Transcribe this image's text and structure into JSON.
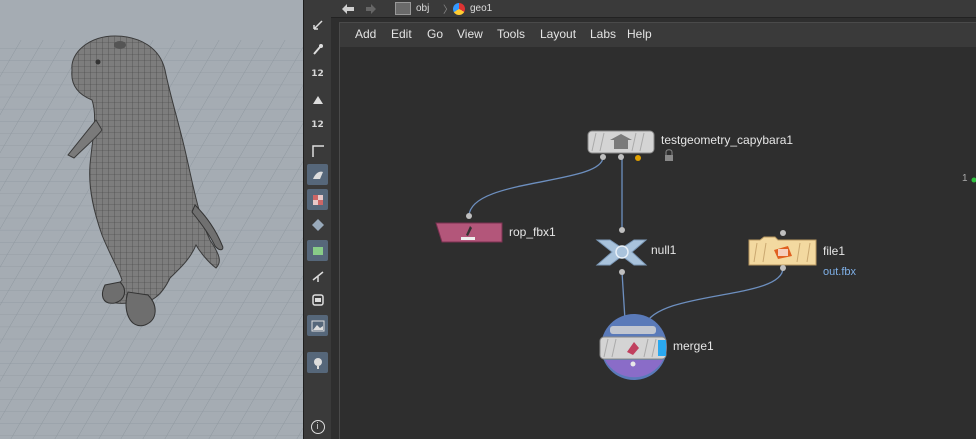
{
  "pathbar": {
    "crumbs": [
      {
        "label": "obj",
        "icon": "obj-folder-icon"
      },
      {
        "label": "geo1",
        "icon": "geo-node-icon"
      }
    ]
  },
  "menubar": {
    "items": [
      "Add",
      "Edit",
      "Go",
      "View",
      "Tools",
      "Layout",
      "Labs",
      "Help"
    ]
  },
  "toolbar": {
    "tools": [
      {
        "icon": "select-arrow-icon",
        "label": ""
      },
      {
        "icon": "paint-brush-icon",
        "label": ""
      },
      {
        "icon": "point-numbers-icon",
        "label": "12"
      },
      {
        "icon": "shade-icon",
        "label": ""
      },
      {
        "icon": "primitive-numbers-icon",
        "label": "12"
      },
      {
        "icon": "corner-icon",
        "label": ""
      },
      {
        "icon": "display-mode-icon",
        "label": ""
      },
      {
        "icon": "checker-icon",
        "label": ""
      },
      {
        "icon": "diamond-icon",
        "label": ""
      },
      {
        "icon": "camera-icon",
        "label": ""
      },
      {
        "icon": "snap-icon",
        "label": ""
      },
      {
        "icon": "square-icon",
        "label": ""
      },
      {
        "icon": "background-image-icon",
        "label": ""
      },
      {
        "icon": "light-icon",
        "label": ""
      },
      {
        "icon": "info-icon",
        "label": "i"
      }
    ]
  },
  "nodes": {
    "testgeometry": {
      "name": "testgeometry_capybara1",
      "flags": [
        "lock-icon",
        "display-flag-icon"
      ]
    },
    "rop_fbx": {
      "name": "rop_fbx1"
    },
    "null": {
      "name": "null1"
    },
    "file": {
      "name": "file1",
      "subtitle": "out.fbx"
    },
    "merge": {
      "name": "merge1"
    }
  },
  "edge_marker": "1",
  "colors": {
    "wire": "#6d8fbf",
    "rop_node": "#b3567a",
    "null_node": "#a9c3dc",
    "file_node": "#f3d9a0",
    "merge_node": "#5a7ab9",
    "testgeo_node": "#d4d4d4",
    "display_flag": "#e0a000"
  }
}
